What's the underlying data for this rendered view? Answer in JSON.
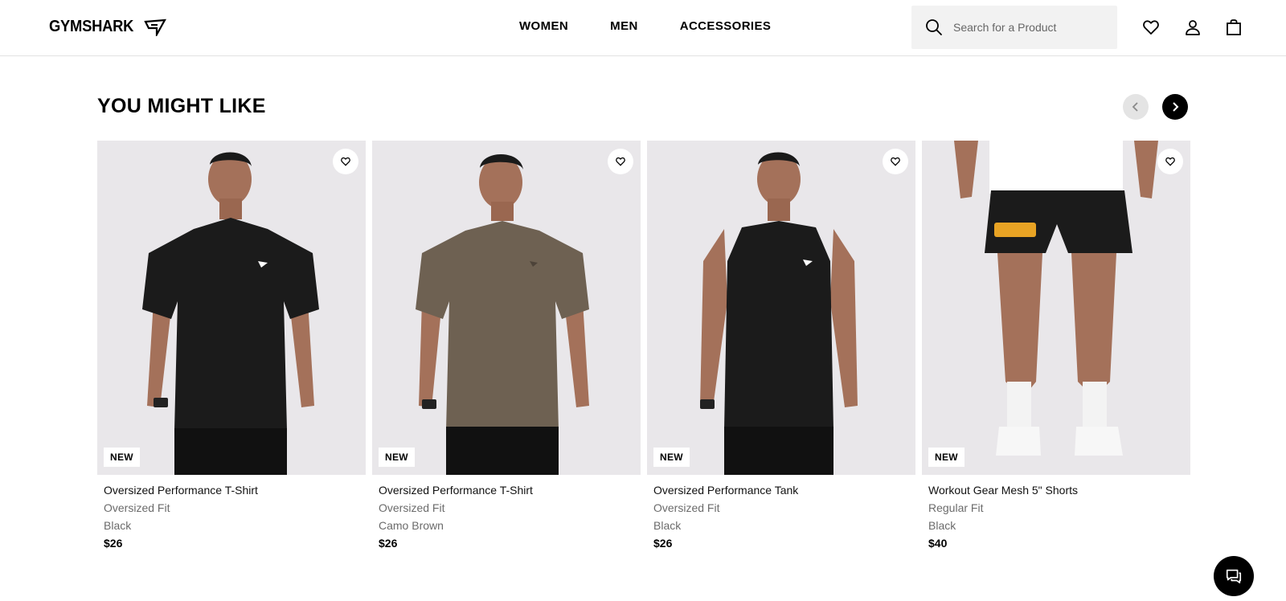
{
  "header": {
    "logo_text": "GYMSHARK",
    "nav": [
      "WOMEN",
      "MEN",
      "ACCESSORIES"
    ],
    "search_placeholder": "Search for a Product"
  },
  "section": {
    "title": "YOU MIGHT LIKE"
  },
  "products": [
    {
      "badge": "NEW",
      "name": "Oversized Performance T-Shirt",
      "fit": "Oversized Fit",
      "color": "Black",
      "price": "$26",
      "garment_color": "#1b1b1b",
      "garment": "tee"
    },
    {
      "badge": "NEW",
      "name": "Oversized Performance T-Shirt",
      "fit": "Oversized Fit",
      "color": "Camo Brown",
      "price": "$26",
      "garment_color": "#6e6152",
      "garment": "tee"
    },
    {
      "badge": "NEW",
      "name": "Oversized Performance Tank",
      "fit": "Oversized Fit",
      "color": "Black",
      "price": "$26",
      "garment_color": "#1b1b1b",
      "garment": "tank"
    },
    {
      "badge": "NEW",
      "name": "Workout Gear Mesh 5\" Shorts",
      "fit": "Regular Fit",
      "color": "Black",
      "price": "$40",
      "garment_color": "#1b1b1b",
      "garment": "shorts"
    }
  ],
  "colors": {
    "image_bg": "#e9e7ea",
    "skin": "#a4715a",
    "accent_print": "#e8a324"
  },
  "icons": {
    "search": "search-icon",
    "wishlist": "heart-icon",
    "account": "user-icon",
    "bag": "bag-icon",
    "prev": "chevron-left-icon",
    "next": "chevron-right-icon",
    "chat": "chat-icon"
  }
}
